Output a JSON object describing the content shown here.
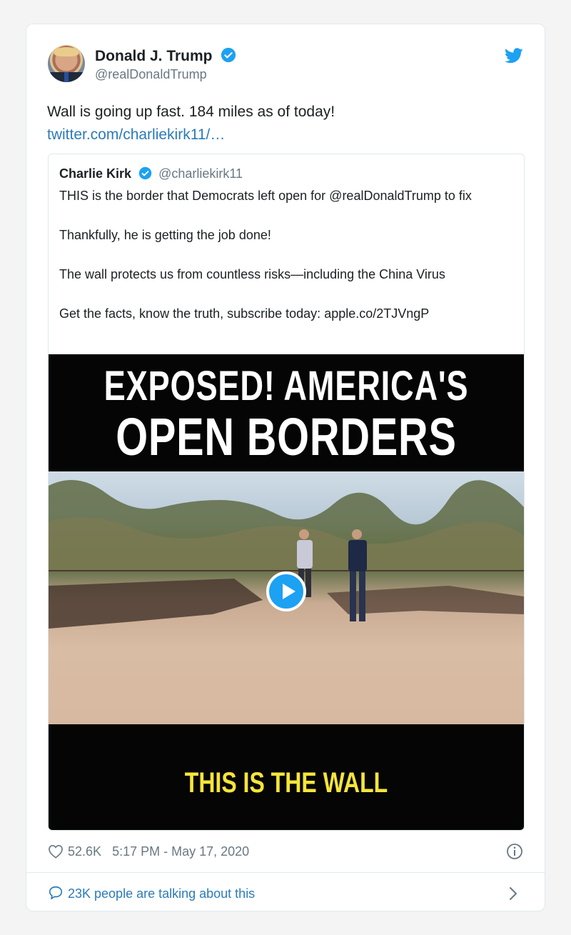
{
  "author": {
    "name": "Donald J. Trump",
    "handle": "@realDonaldTrump"
  },
  "tweet": {
    "text": "Wall is going up fast. 184 miles as of today!",
    "link": "twitter.com/charliekirk11/…"
  },
  "quote": {
    "name": "Charlie Kirk",
    "handle": "@charliekirk11",
    "paragraphs": [
      "THIS is the border that Democrats left open for @realDonaldTrump to fix",
      "Thankfully, he is getting the job done!",
      "The wall protects us from countless risks—including the China Virus",
      "Get the facts, know the truth, subscribe today: apple.co/2TJVngP"
    ],
    "media": {
      "headline_line1": "EXPOSED! AMERICA'S",
      "headline_line2": "OPEN BORDERS",
      "caption": "THIS IS THE WALL"
    }
  },
  "meta": {
    "likes": "52.6K",
    "timestamp": "5:17 PM - May 17, 2020"
  },
  "conversation": {
    "label": "23K people are talking about this"
  },
  "icons": {
    "verified": "verified-badge-icon",
    "logo": "twitter-bird-icon",
    "like": "heart-icon",
    "info": "info-icon",
    "reply": "speech-bubble-icon",
    "chevron": "chevron-right-icon",
    "play": "play-icon"
  },
  "colors": {
    "accent": "#1da1f2",
    "link": "#2b7bb9",
    "secondary_text": "#697882",
    "caption_yellow": "#f5e53a"
  }
}
